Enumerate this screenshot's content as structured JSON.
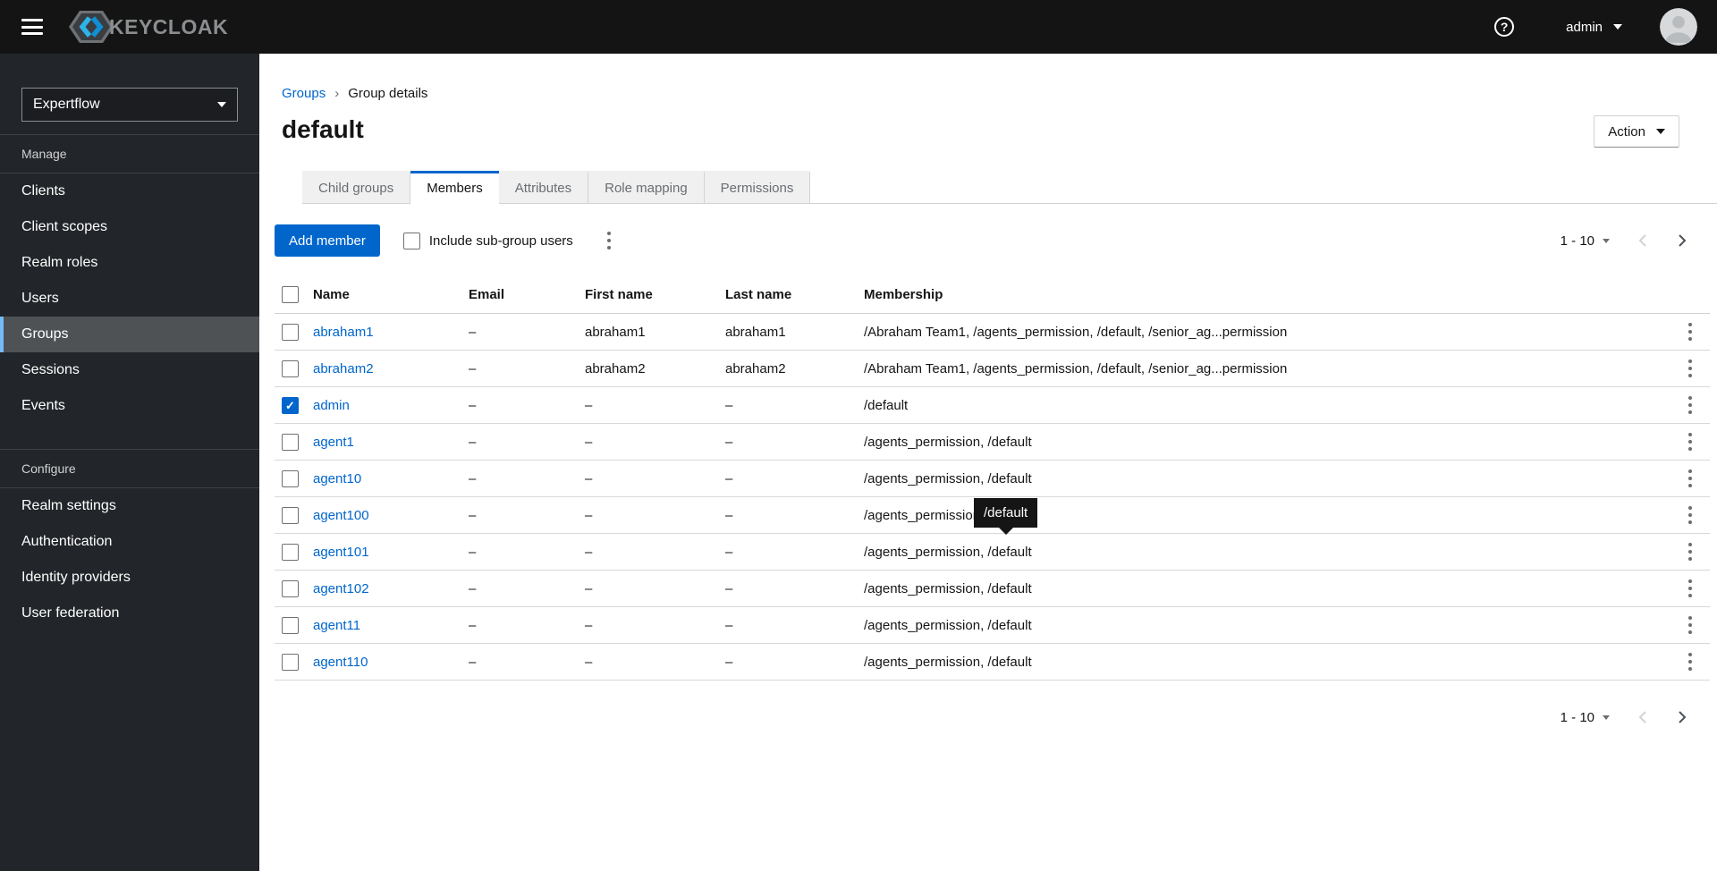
{
  "masthead": {
    "brand_text": "KEYCLOAK",
    "help_label": "?",
    "username": "admin"
  },
  "sidebar": {
    "realm_selector": "Expertflow",
    "sections": [
      {
        "label": "Manage",
        "items": [
          {
            "label": "Clients",
            "active": false
          },
          {
            "label": "Client scopes",
            "active": false
          },
          {
            "label": "Realm roles",
            "active": false
          },
          {
            "label": "Users",
            "active": false
          },
          {
            "label": "Groups",
            "active": true
          },
          {
            "label": "Sessions",
            "active": false
          },
          {
            "label": "Events",
            "active": false
          }
        ]
      },
      {
        "label": "Configure",
        "items": [
          {
            "label": "Realm settings",
            "active": false
          },
          {
            "label": "Authentication",
            "active": false
          },
          {
            "label": "Identity providers",
            "active": false
          },
          {
            "label": "User federation",
            "active": false
          }
        ]
      }
    ]
  },
  "breadcrumb": {
    "parent": "Groups",
    "separator": "›",
    "current": "Group details"
  },
  "page_header": {
    "title": "default",
    "action_button": "Action"
  },
  "tabs": [
    {
      "label": "Child groups",
      "active": false
    },
    {
      "label": "Members",
      "active": true
    },
    {
      "label": "Attributes",
      "active": false
    },
    {
      "label": "Role mapping",
      "active": false
    },
    {
      "label": "Permissions",
      "active": false
    }
  ],
  "toolbar": {
    "add_member_button": "Add member",
    "include_subgroup_label": "Include sub-group users",
    "include_subgroup_checked": false
  },
  "pagination": {
    "range_label": "1 - 10"
  },
  "members_table": {
    "headers": [
      "Name",
      "Email",
      "First name",
      "Last name",
      "Membership"
    ],
    "rows": [
      {
        "checked": false,
        "name": "abraham1",
        "email": "–",
        "first_name": "abraham1",
        "last_name": "abraham1",
        "membership": "/Abraham Team1, /agents_permission, /default, /senior_ag...permission"
      },
      {
        "checked": false,
        "name": "abraham2",
        "email": "–",
        "first_name": "abraham2",
        "last_name": "abraham2",
        "membership": "/Abraham Team1, /agents_permission, /default, /senior_ag...permission"
      },
      {
        "checked": true,
        "name": "admin",
        "email": "–",
        "first_name": "–",
        "last_name": "–",
        "membership": "/default"
      },
      {
        "checked": false,
        "name": "agent1",
        "email": "–",
        "first_name": "–",
        "last_name": "–",
        "membership": "/agents_permission, /default"
      },
      {
        "checked": false,
        "name": "agent10",
        "email": "–",
        "first_name": "–",
        "last_name": "–",
        "membership": "/agents_permission, /default"
      },
      {
        "checked": false,
        "name": "agent100",
        "email": "–",
        "first_name": "–",
        "last_name": "–",
        "membership": "/agents_permission, /default"
      },
      {
        "checked": false,
        "name": "agent101",
        "email": "–",
        "first_name": "–",
        "last_name": "–",
        "membership": "/agents_permission, /default"
      },
      {
        "checked": false,
        "name": "agent102",
        "email": "–",
        "first_name": "–",
        "last_name": "–",
        "membership": "/agents_permission, /default"
      },
      {
        "checked": false,
        "name": "agent11",
        "email": "–",
        "first_name": "–",
        "last_name": "–",
        "membership": "/agents_permission, /default"
      },
      {
        "checked": false,
        "name": "agent110",
        "email": "–",
        "first_name": "–",
        "last_name": "–",
        "membership": "/agents_permission, /default"
      }
    ]
  },
  "tooltip": {
    "text": "/default"
  },
  "colors": {
    "accent": "#0066cc",
    "masthead_bg": "#141414",
    "sidebar_bg": "#222529",
    "active_nav_bg": "#4f5255",
    "active_nav_border": "#73bcf7",
    "link": "#0066cc",
    "tooltip_bg": "#151515"
  }
}
